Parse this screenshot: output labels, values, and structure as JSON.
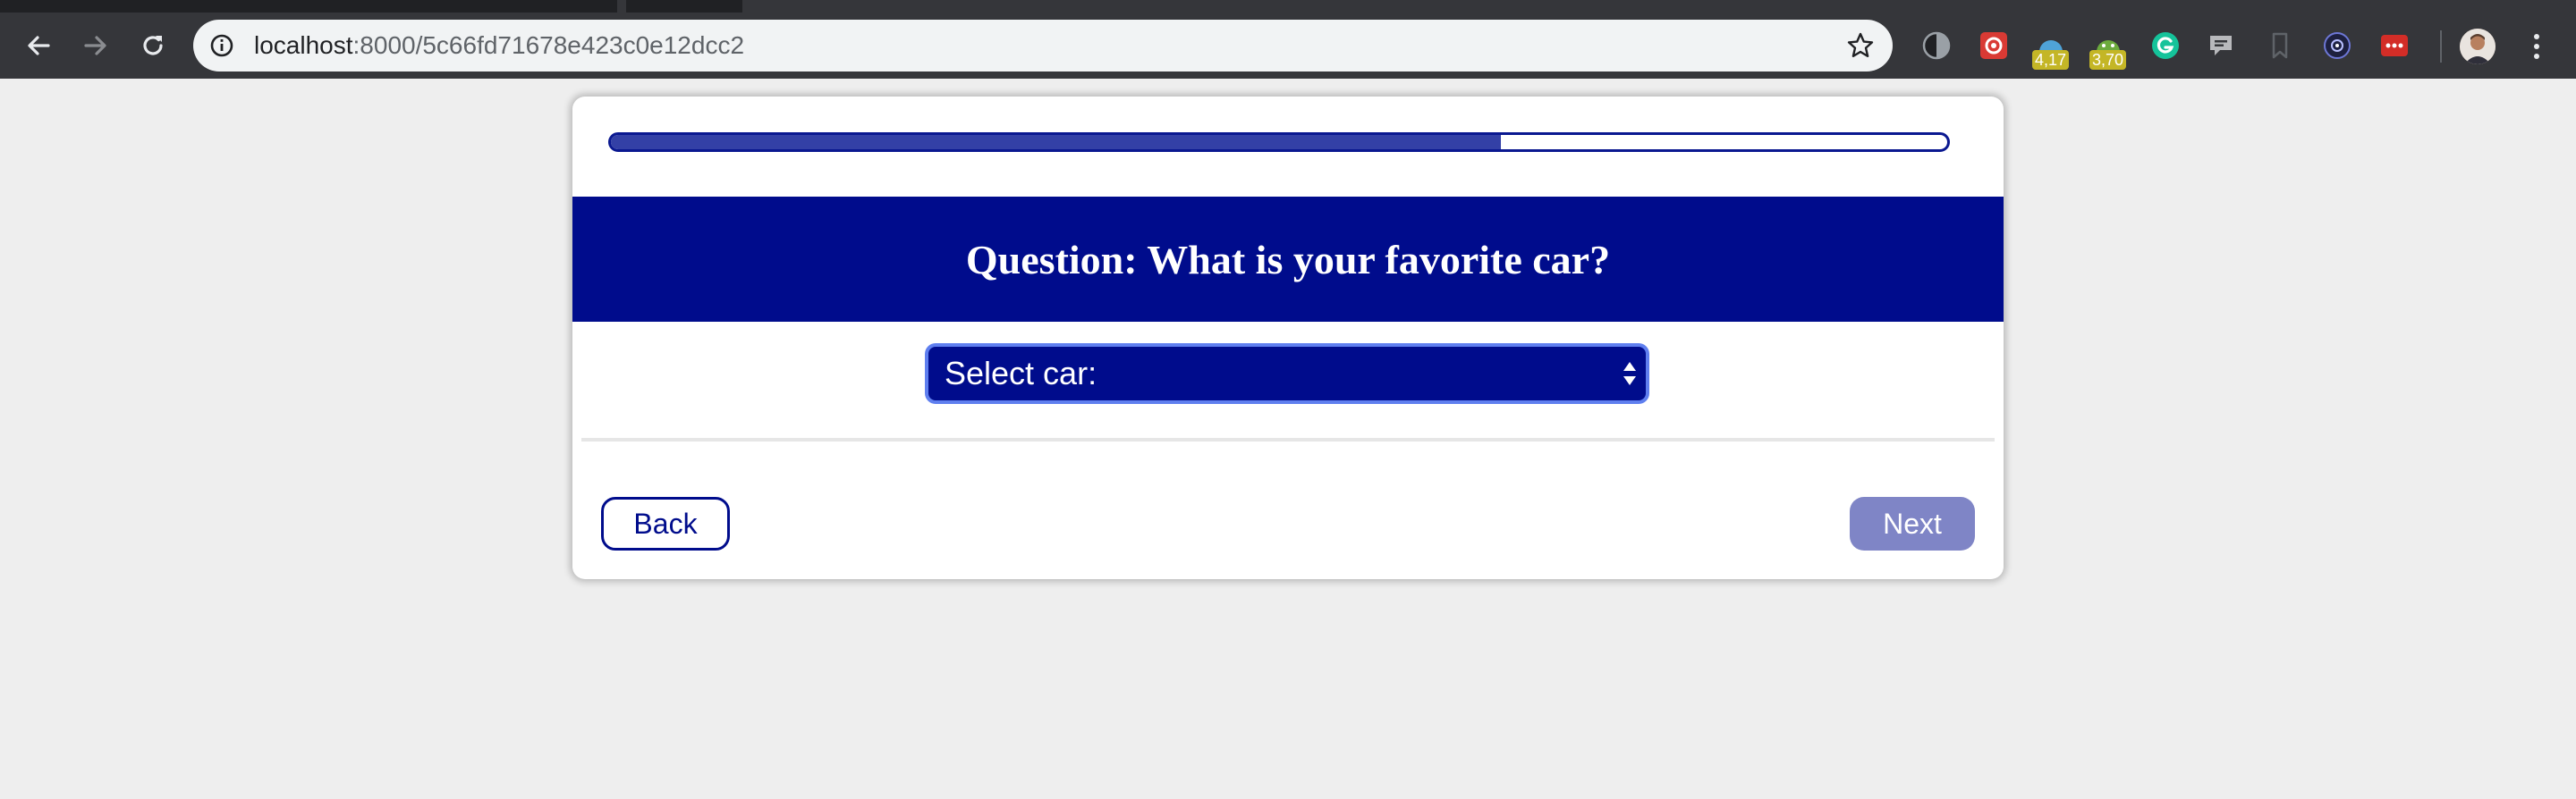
{
  "browser": {
    "url_host": "localhost",
    "url_rest": ":8000/5c66fd71678e423c0e12dcc2",
    "extensions": [
      {
        "icon": "contrast-icon"
      },
      {
        "icon": "red-extension-icon"
      },
      {
        "icon": "blue-extension-icon",
        "badge": "4,17"
      },
      {
        "icon": "android-extension-icon",
        "badge": "3,70"
      },
      {
        "icon": "grammarly-icon"
      },
      {
        "icon": "comment-extension-icon"
      },
      {
        "icon": "bookmark-icon"
      },
      {
        "icon": "target-extension-icon"
      },
      {
        "icon": "lastpass-icon"
      }
    ]
  },
  "survey": {
    "progress_fraction": 0.666,
    "question": "Question: What is your favorite car?",
    "select": {
      "selected": "Select car:"
    },
    "back_label": "Back",
    "next_label": "Next"
  },
  "colors": {
    "primary": "#000c8c",
    "progress_fill": "#3340a6",
    "next_disabled": "#7f85c6",
    "page_bg": "#eeeeee"
  }
}
